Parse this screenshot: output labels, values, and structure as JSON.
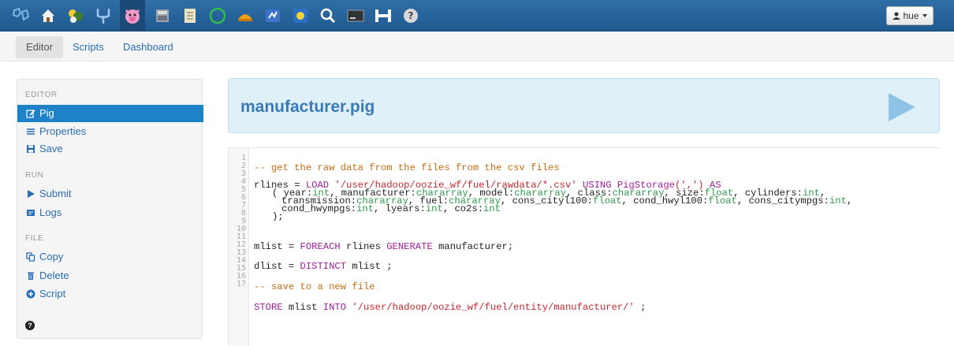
{
  "topbar": {
    "apps": [
      {
        "name": "hue-logo-icon"
      },
      {
        "name": "home-icon"
      },
      {
        "name": "hive-icon"
      },
      {
        "name": "oozie-icon"
      },
      {
        "name": "pig-icon",
        "active": true
      },
      {
        "name": "metastore-icon"
      },
      {
        "name": "file-browser-icon"
      },
      {
        "name": "job-browser-icon"
      },
      {
        "name": "impala-icon"
      },
      {
        "name": "job-designer-icon"
      },
      {
        "name": "beeswax-icon"
      },
      {
        "name": "search-icon"
      },
      {
        "name": "shell-icon"
      },
      {
        "name": "hbase-icon"
      },
      {
        "name": "help-icon"
      }
    ],
    "user_label": "hue"
  },
  "subnav": {
    "editor": "Editor",
    "scripts": "Scripts",
    "dashboard": "Dashboard"
  },
  "sidebar": {
    "editor_header": "EDITOR",
    "pig": "Pig",
    "properties": "Properties",
    "save": "Save",
    "run_header": "RUN",
    "submit": "Submit",
    "logs": "Logs",
    "file_header": "FILE",
    "copy": "Copy",
    "delete": "Delete",
    "script": "Script"
  },
  "banner": {
    "title": "manufacturer.pig"
  },
  "code": {
    "line_numbers": [
      "1",
      "2",
      "3",
      "4",
      "5",
      "6",
      "7",
      "8",
      "9",
      "10",
      "11",
      "12",
      "13",
      "14",
      "15",
      "16",
      "17"
    ],
    "l2": "-- get the raw data from the files from the csv files",
    "l4_a": "rlines = ",
    "l4_load": "LOAD",
    "l4_path": "'/user/hadoop/oozie_wf/fuel/rawdata/*.csv'",
    "l4_using": "USING",
    "l4_storage": "PigStorage",
    "l4_sep": "(',')",
    "l4_as": "AS",
    "l5": "( year:int, manufacturer:chararray, model:chararray, class:chararray, size:float, cylinders:int,",
    "l6": "transmission:chararray, fuel:chararray, cons_cityl100:float, cond_hwyl100:float, cons_citympgs:int,",
    "l7": "cond_hwympgs:int, lyears:int, co2s:int",
    "l8": ");",
    "l10_a": "mlist = ",
    "l10_foreach": "FOREACH",
    "l10_b": " rlines ",
    "l10_generate": "GENERATE",
    "l10_c": " manufacturer;",
    "l12_a": "dlist = ",
    "l12_distinct": "DISTINCT",
    "l12_b": " mlist ;",
    "l14": "-- save to a new file",
    "l16_store": "STORE",
    "l16_a": " mlist ",
    "l16_into": "INTO",
    "l16_path": "'/user/hadoop/oozie_wf/fuel/entity/manufacturer/'",
    "l16_b": " ;"
  }
}
